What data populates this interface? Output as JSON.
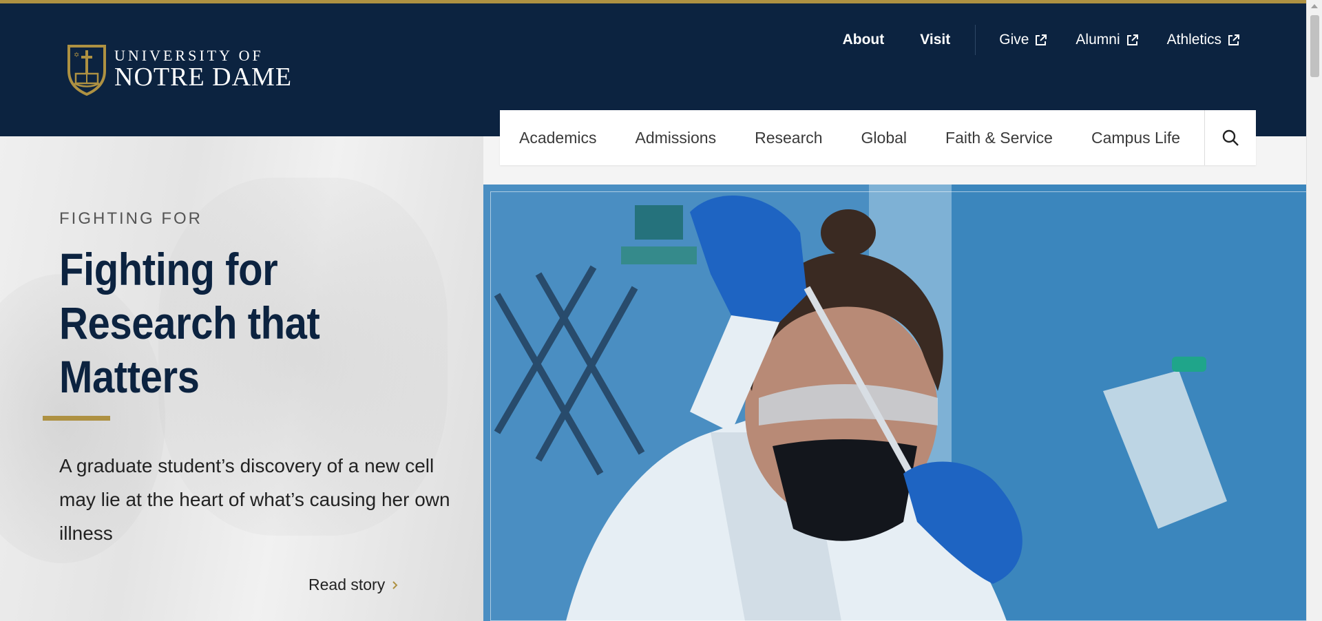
{
  "brand": {
    "line1": "UNIVERSITY OF",
    "line2": "NOTRE DAME",
    "colors": {
      "navy": "#0c2340",
      "gold": "#ae9142"
    }
  },
  "utility_nav": {
    "items": [
      {
        "label": "About",
        "bold": true
      },
      {
        "label": "Visit",
        "bold": true
      },
      {
        "label": "Give",
        "external": true
      },
      {
        "label": "Alumni",
        "external": true
      },
      {
        "label": "Athletics",
        "external": true
      }
    ]
  },
  "main_nav": {
    "items": [
      "Academics",
      "Admissions",
      "Research",
      "Global",
      "Faith & Service",
      "Campus Life"
    ],
    "search_icon": "search-icon"
  },
  "hero": {
    "eyebrow": "FIGHTING FOR",
    "headline_lines": [
      "Fighting for",
      "Research that",
      "Matters"
    ],
    "dek": "A graduate student’s discovery of a new cell may lie at the heart of what’s causing her own illness",
    "cta": "Read story",
    "image_subject": "researcher-with-pipette-photo"
  }
}
